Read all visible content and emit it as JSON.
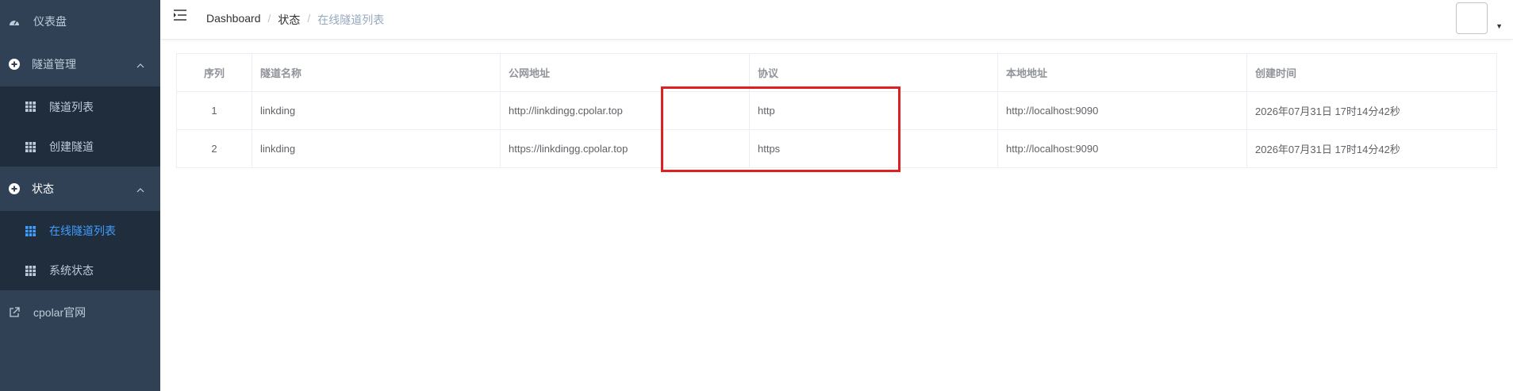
{
  "sidebar": {
    "items": [
      {
        "label": "仪表盘",
        "icon": "dashboard-icon"
      },
      {
        "label": "隧道管理",
        "icon": "plus-circle-icon"
      },
      {
        "label": "隧道列表",
        "icon": "table-icon"
      },
      {
        "label": "创建隧道",
        "icon": "table-icon"
      },
      {
        "label": "状态",
        "icon": "plus-circle-icon"
      },
      {
        "label": "在线隧道列表",
        "icon": "table-icon"
      },
      {
        "label": "系统状态",
        "icon": "table-icon"
      },
      {
        "label": "cpolar官网",
        "icon": "external-link-icon"
      }
    ],
    "active_color": "#409eff"
  },
  "breadcrumb": [
    "Dashboard",
    "状态",
    "在线隧道列表"
  ],
  "table": {
    "headers": [
      "序列",
      "隧道名称",
      "公网地址",
      "协议",
      "本地地址",
      "创建时间"
    ],
    "rows": [
      [
        "1",
        "linkding",
        "http://linkdingg.cpolar.top",
        "http",
        "http://localhost:9090",
        "2026年07月31日 17时14分42秒"
      ],
      [
        "2",
        "linkding",
        "https://linkdingg.cpolar.top",
        "https",
        "http://localhost:9090",
        "2026年07月31日 17时14分42秒"
      ]
    ]
  },
  "highlight_color": "#e02020"
}
